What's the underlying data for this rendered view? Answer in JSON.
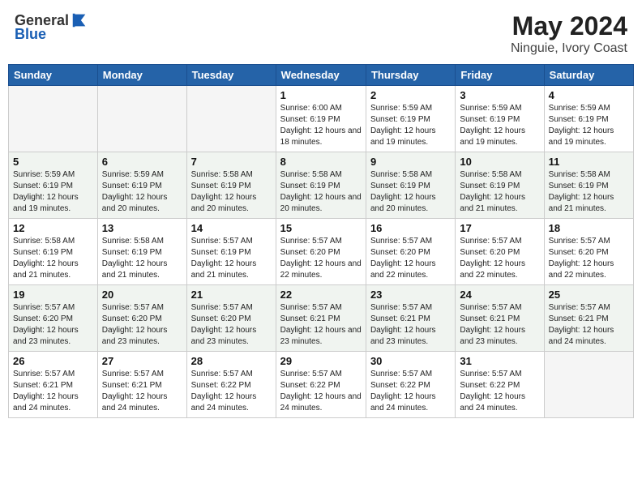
{
  "header": {
    "logo_line1": "General",
    "logo_line2": "Blue",
    "month": "May 2024",
    "location": "Ninguie, Ivory Coast"
  },
  "days_of_week": [
    "Sunday",
    "Monday",
    "Tuesday",
    "Wednesday",
    "Thursday",
    "Friday",
    "Saturday"
  ],
  "weeks": [
    [
      {
        "day": "",
        "info": ""
      },
      {
        "day": "",
        "info": ""
      },
      {
        "day": "",
        "info": ""
      },
      {
        "day": "1",
        "info": "Sunrise: 6:00 AM\nSunset: 6:19 PM\nDaylight: 12 hours and 18 minutes."
      },
      {
        "day": "2",
        "info": "Sunrise: 5:59 AM\nSunset: 6:19 PM\nDaylight: 12 hours and 19 minutes."
      },
      {
        "day": "3",
        "info": "Sunrise: 5:59 AM\nSunset: 6:19 PM\nDaylight: 12 hours and 19 minutes."
      },
      {
        "day": "4",
        "info": "Sunrise: 5:59 AM\nSunset: 6:19 PM\nDaylight: 12 hours and 19 minutes."
      }
    ],
    [
      {
        "day": "5",
        "info": "Sunrise: 5:59 AM\nSunset: 6:19 PM\nDaylight: 12 hours and 19 minutes."
      },
      {
        "day": "6",
        "info": "Sunrise: 5:59 AM\nSunset: 6:19 PM\nDaylight: 12 hours and 20 minutes."
      },
      {
        "day": "7",
        "info": "Sunrise: 5:58 AM\nSunset: 6:19 PM\nDaylight: 12 hours and 20 minutes."
      },
      {
        "day": "8",
        "info": "Sunrise: 5:58 AM\nSunset: 6:19 PM\nDaylight: 12 hours and 20 minutes."
      },
      {
        "day": "9",
        "info": "Sunrise: 5:58 AM\nSunset: 6:19 PM\nDaylight: 12 hours and 20 minutes."
      },
      {
        "day": "10",
        "info": "Sunrise: 5:58 AM\nSunset: 6:19 PM\nDaylight: 12 hours and 21 minutes."
      },
      {
        "day": "11",
        "info": "Sunrise: 5:58 AM\nSunset: 6:19 PM\nDaylight: 12 hours and 21 minutes."
      }
    ],
    [
      {
        "day": "12",
        "info": "Sunrise: 5:58 AM\nSunset: 6:19 PM\nDaylight: 12 hours and 21 minutes."
      },
      {
        "day": "13",
        "info": "Sunrise: 5:58 AM\nSunset: 6:19 PM\nDaylight: 12 hours and 21 minutes."
      },
      {
        "day": "14",
        "info": "Sunrise: 5:57 AM\nSunset: 6:19 PM\nDaylight: 12 hours and 21 minutes."
      },
      {
        "day": "15",
        "info": "Sunrise: 5:57 AM\nSunset: 6:20 PM\nDaylight: 12 hours and 22 minutes."
      },
      {
        "day": "16",
        "info": "Sunrise: 5:57 AM\nSunset: 6:20 PM\nDaylight: 12 hours and 22 minutes."
      },
      {
        "day": "17",
        "info": "Sunrise: 5:57 AM\nSunset: 6:20 PM\nDaylight: 12 hours and 22 minutes."
      },
      {
        "day": "18",
        "info": "Sunrise: 5:57 AM\nSunset: 6:20 PM\nDaylight: 12 hours and 22 minutes."
      }
    ],
    [
      {
        "day": "19",
        "info": "Sunrise: 5:57 AM\nSunset: 6:20 PM\nDaylight: 12 hours and 23 minutes."
      },
      {
        "day": "20",
        "info": "Sunrise: 5:57 AM\nSunset: 6:20 PM\nDaylight: 12 hours and 23 minutes."
      },
      {
        "day": "21",
        "info": "Sunrise: 5:57 AM\nSunset: 6:20 PM\nDaylight: 12 hours and 23 minutes."
      },
      {
        "day": "22",
        "info": "Sunrise: 5:57 AM\nSunset: 6:21 PM\nDaylight: 12 hours and 23 minutes."
      },
      {
        "day": "23",
        "info": "Sunrise: 5:57 AM\nSunset: 6:21 PM\nDaylight: 12 hours and 23 minutes."
      },
      {
        "day": "24",
        "info": "Sunrise: 5:57 AM\nSunset: 6:21 PM\nDaylight: 12 hours and 23 minutes."
      },
      {
        "day": "25",
        "info": "Sunrise: 5:57 AM\nSunset: 6:21 PM\nDaylight: 12 hours and 24 minutes."
      }
    ],
    [
      {
        "day": "26",
        "info": "Sunrise: 5:57 AM\nSunset: 6:21 PM\nDaylight: 12 hours and 24 minutes."
      },
      {
        "day": "27",
        "info": "Sunrise: 5:57 AM\nSunset: 6:21 PM\nDaylight: 12 hours and 24 minutes."
      },
      {
        "day": "28",
        "info": "Sunrise: 5:57 AM\nSunset: 6:22 PM\nDaylight: 12 hours and 24 minutes."
      },
      {
        "day": "29",
        "info": "Sunrise: 5:57 AM\nSunset: 6:22 PM\nDaylight: 12 hours and 24 minutes."
      },
      {
        "day": "30",
        "info": "Sunrise: 5:57 AM\nSunset: 6:22 PM\nDaylight: 12 hours and 24 minutes."
      },
      {
        "day": "31",
        "info": "Sunrise: 5:57 AM\nSunset: 6:22 PM\nDaylight: 12 hours and 24 minutes."
      },
      {
        "day": "",
        "info": ""
      }
    ]
  ]
}
